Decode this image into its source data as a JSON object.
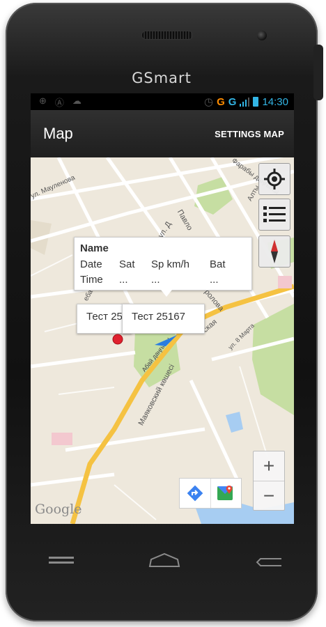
{
  "device": {
    "brand": "GSmart"
  },
  "statusbar": {
    "time": "14:30",
    "network1": "G",
    "network2": "G",
    "signal_icon": "signal-bars-icon",
    "battery_icon": "battery-icon"
  },
  "actionbar": {
    "title": "Map",
    "action": "SETTINGS MAP"
  },
  "map": {
    "streets": [
      "ул. Мауленова",
      "Фарабы даңғылы",
      "Алты",
      "ул. Д",
      "Павло",
      "Абая",
      "Фролова",
      "ская",
      "ул. 8 Марта",
      "Абай даңғылы",
      "Маяковский көшесі",
      "ебаев"
    ],
    "info_window": {
      "name_label": "Name",
      "headers": [
        "Date",
        "Sat",
        "Sp km/h",
        "Bat"
      ],
      "row_label": "Time",
      "values": [
        "...",
        "...",
        "..."
      ]
    },
    "markers": [
      {
        "label": "Тест 25167",
        "color": "#e0212f"
      },
      {
        "label": "Тест 25167",
        "color": "#2a7de1"
      }
    ],
    "zoom": {
      "in": "+",
      "out": "−"
    },
    "attribution": "Google"
  }
}
